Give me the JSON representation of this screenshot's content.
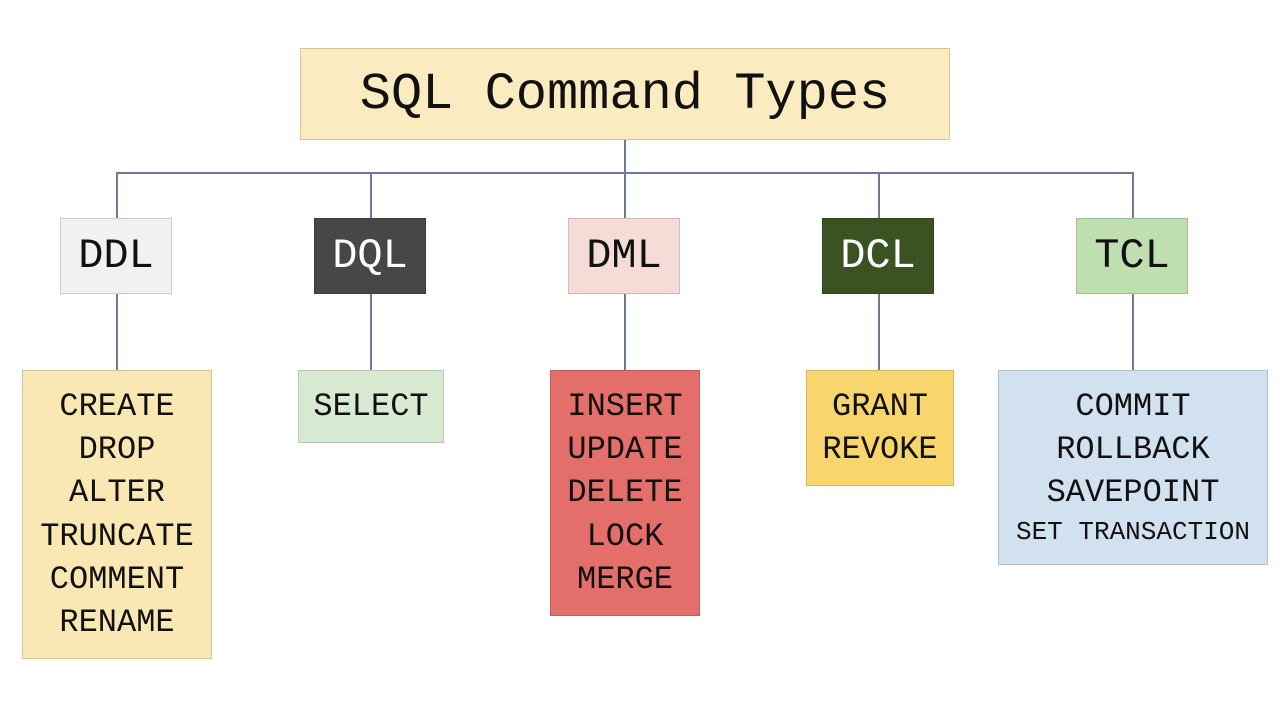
{
  "title": "SQL Command Types",
  "categories": [
    {
      "code": "DDL",
      "boxColor": "#f1f1f1",
      "textColor": "#111111",
      "cmdBoxColor": "#f9e8b4",
      "commands": [
        "CREATE",
        "DROP",
        "ALTER",
        "TRUNCATE",
        "COMMENT",
        "RENAME"
      ]
    },
    {
      "code": "DQL",
      "boxColor": "#474747",
      "textColor": "#ffffff",
      "cmdBoxColor": "#d9ead3",
      "commands": [
        "SELECT"
      ]
    },
    {
      "code": "DML",
      "boxColor": "#f6dcd6",
      "textColor": "#111111",
      "cmdBoxColor": "#e46f6a",
      "commands": [
        "INSERT",
        "UPDATE",
        "DELETE",
        "LOCK",
        "MERGE"
      ]
    },
    {
      "code": "DCL",
      "boxColor": "#3b5323",
      "textColor": "#ffffff",
      "cmdBoxColor": "#f9d56e",
      "commands": [
        "GRANT",
        "REVOKE"
      ]
    },
    {
      "code": "TCL",
      "boxColor": "#c0dfb0",
      "textColor": "#111111",
      "cmdBoxColor": "#d2e1f0",
      "commands": [
        "COMMIT",
        "ROLLBACK",
        "SAVEPOINT",
        "SET TRANSACTION"
      ]
    }
  ]
}
